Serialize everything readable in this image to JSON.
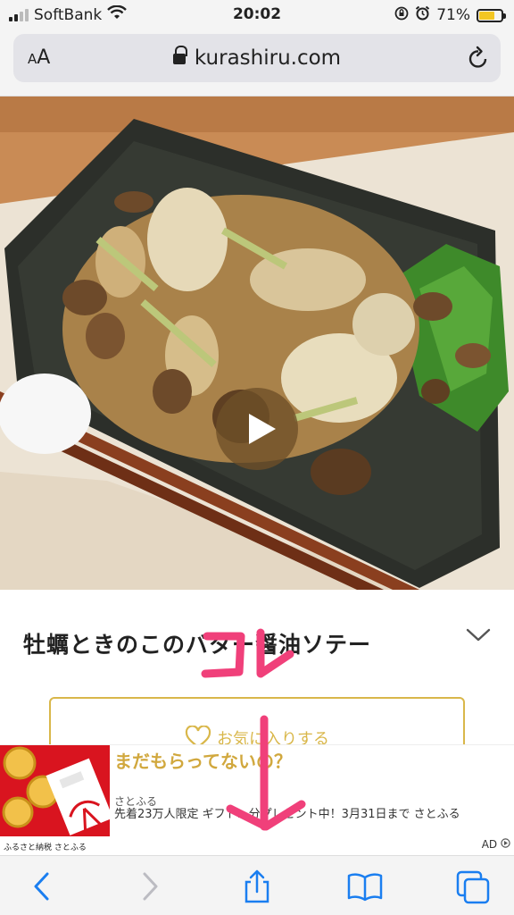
{
  "status_bar": {
    "carrier": "SoftBank",
    "time": "20:02",
    "battery": "71%",
    "battery_level": 0.71,
    "icons": [
      "signal-icon",
      "wifi-icon",
      "orientation-lock-icon",
      "alarm-icon",
      "battery-icon"
    ]
  },
  "browser": {
    "text_size_label": "AA",
    "url": "kurashiru.com",
    "icons": [
      "lock-icon",
      "reload-icon"
    ]
  },
  "recipe": {
    "title": "牡蠣ときのこのバター醤油ソテー",
    "favorite_label": "お気に入りする",
    "icons": [
      "play-icon",
      "chevron-down-icon",
      "heart-icon"
    ]
  },
  "annotation": {
    "text": "コレ",
    "color": "#f0407a"
  },
  "ad": {
    "headline": "まだもらってないの？",
    "sponsor": "さとふる",
    "body": "先着23万人限定 ギフト…分プレゼント中！3月31日まで さとふる",
    "image_caption": "ふるさと納税 さとふる",
    "badge": "AD",
    "colors": {
      "headline": "#d1a83e",
      "image_bg": "#d9141f"
    }
  },
  "toolbar": {
    "icons": [
      "back-icon",
      "forward-icon",
      "share-icon",
      "bookmarks-icon",
      "tabs-icon"
    ],
    "accent": "#1a7ef0"
  }
}
